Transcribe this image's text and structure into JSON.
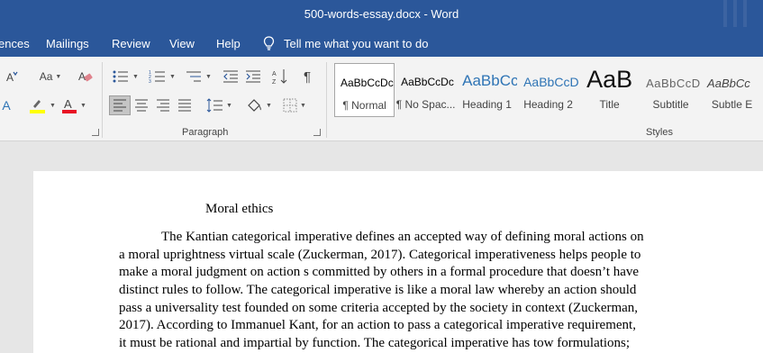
{
  "window": {
    "title": "500-words-essay.docx  -  Word"
  },
  "menu": {
    "tabs": [
      "ences",
      "Mailings",
      "Review",
      "View",
      "Help"
    ],
    "tell_me": "Tell me what you want to do"
  },
  "ribbon": {
    "font_group": {
      "font_size_label": "Aa"
    },
    "paragraph_label": "Paragraph",
    "styles_label": "Styles",
    "styles": [
      {
        "sample": "AaBbCcDc",
        "name": "¶ Normal",
        "selected": true
      },
      {
        "sample": "AaBbCcDc",
        "name": "¶ No Spac...",
        "selected": false
      },
      {
        "sample": "AaBbCc",
        "name": "Heading 1",
        "selected": false
      },
      {
        "sample": "AaBbCcD",
        "name": "Heading 2",
        "selected": false
      },
      {
        "sample": "AaB",
        "name": "Title",
        "selected": false
      },
      {
        "sample": "AaBbCcD",
        "name": "Subtitle",
        "selected": false
      },
      {
        "sample": "AaBbCc",
        "name": "Subtle E",
        "selected": false
      }
    ]
  },
  "document": {
    "title": "Moral ethics",
    "lines": [
      "The Kantian categorical imperative defines an accepted way of defining moral actions on",
      "a moral uprightness virtual scale (Zuckerman, 2017).  Categorical imperativeness helps people to",
      "make a moral judgment on action s committed by others in a formal procedure that doesn’t have",
      "distinct rules to follow. The categorical imperative is like a moral law whereby an action should",
      "pass a universality test founded on some criteria accepted by the society in context (Zuckerman,",
      "2017). According to Immanuel Kant, for an action to pass a categorical imperative requirement,",
      "it must be rational and impartial by function. The categorical imperative has tow formulations;"
    ]
  },
  "colors": {
    "title_bar": "#2b579a",
    "ribbon": "#f3f3f3",
    "heading_blue": "#2e74b5",
    "font_color_red": "#e81123",
    "highlight_yellow": "#ffff00"
  }
}
